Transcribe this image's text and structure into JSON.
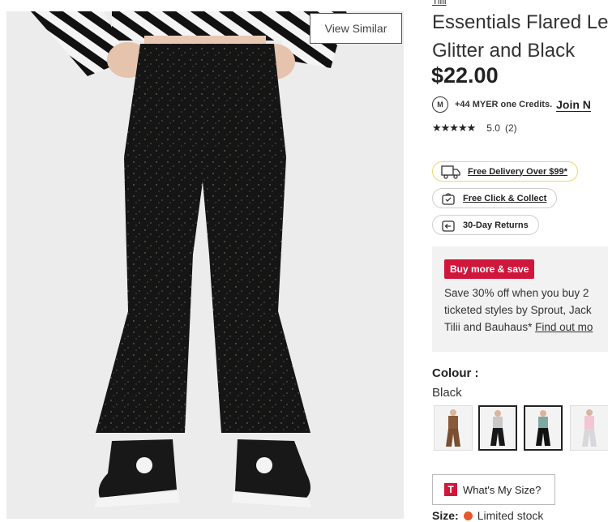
{
  "product": {
    "brand": "Tilii",
    "title_line1": "Essentials Flared Le",
    "title_line2": "Glitter and Black",
    "price": "$22.00",
    "view_similar": "View Similar"
  },
  "credits": {
    "badge": "M",
    "text": "+44 MYER one Credits.",
    "join": "Join N"
  },
  "rating": {
    "stars": "★★★★★",
    "score": "5.0",
    "count": "(2)"
  },
  "services": [
    {
      "label": "Free Delivery Over $99*",
      "icon": "truck-icon"
    },
    {
      "label": "Free Click & Collect",
      "icon": "bag-icon"
    },
    {
      "label": "30-Day Returns",
      "icon": "returns-icon"
    }
  ],
  "promo": {
    "badge": "Buy more & save",
    "line1": "Save 30% off when you buy 2",
    "line2": "ticketed styles by Sprout, Jack",
    "line3": "Tilii and Bauhaus*",
    "link": "Find out mo"
  },
  "colour": {
    "label": "Colour :",
    "value": "Black",
    "swatches": [
      "Brown",
      "Black",
      "Black",
      "Pink"
    ]
  },
  "size": {
    "guide_icon": "T",
    "guide_label": "What's My Size?",
    "label": "Size:",
    "stock": "Limited stock"
  },
  "colors": {
    "accent": "#d1163b",
    "stock_dot": "#e8562a",
    "delivery_border": "#e9d86c"
  }
}
